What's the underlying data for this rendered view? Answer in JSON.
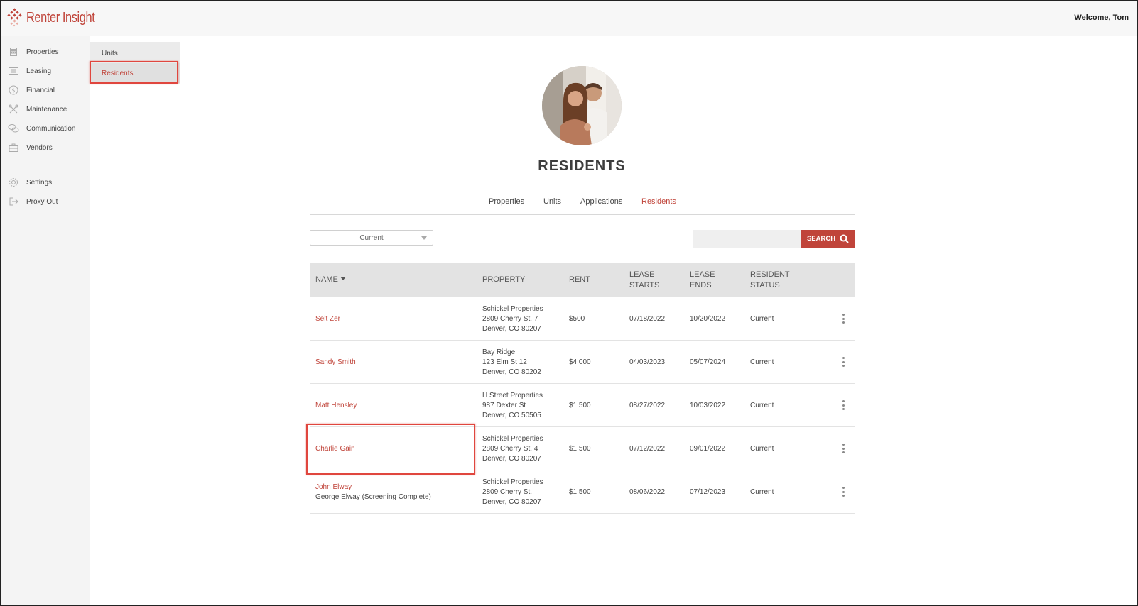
{
  "brand": {
    "name": "Renter Insight",
    "color": "#c0443a"
  },
  "header": {
    "welcome": "Welcome, Tom"
  },
  "leftnav": {
    "items": [
      {
        "label": "Properties",
        "icon": "building-icon"
      },
      {
        "label": "Leasing",
        "icon": "list-icon"
      },
      {
        "label": "Financial",
        "icon": "dollar-icon"
      },
      {
        "label": "Maintenance",
        "icon": "tools-icon"
      },
      {
        "label": "Communication",
        "icon": "chat-icon"
      },
      {
        "label": "Vendors",
        "icon": "briefcase-icon"
      },
      {
        "label": "Settings",
        "icon": "gear-icon"
      },
      {
        "label": "Proxy Out",
        "icon": "logout-icon"
      }
    ]
  },
  "subnav": {
    "items": [
      {
        "label": "Units"
      },
      {
        "label": "Residents",
        "active": true
      }
    ]
  },
  "page": {
    "title": "RESIDENTS"
  },
  "tabs": [
    {
      "label": "Properties"
    },
    {
      "label": "Units"
    },
    {
      "label": "Applications"
    },
    {
      "label": "Residents",
      "active": true
    }
  ],
  "filters": {
    "status_selected": "Current",
    "search_value": "",
    "search_label": "SEARCH"
  },
  "table": {
    "headers": {
      "name": "NAME",
      "property": "PROPERTY",
      "rent": "RENT",
      "lease_starts_1": "LEASE",
      "lease_starts_2": "STARTS",
      "lease_ends_1": "LEASE",
      "lease_ends_2": "ENDS",
      "status_1": "RESIDENT",
      "status_2": "STATUS"
    },
    "rows": [
      {
        "name": "Selt Zer",
        "sub": "",
        "property": [
          "Schickel Properties",
          "2809 Cherry St. 7",
          "Denver, CO 80207"
        ],
        "rent": "$500",
        "start": "07/18/2022",
        "end": "10/20/2022",
        "status": "Current"
      },
      {
        "name": "Sandy Smith",
        "sub": "",
        "property": [
          "Bay Ridge",
          "123 Elm St 12",
          "Denver, CO 80202"
        ],
        "rent": "$4,000",
        "start": "04/03/2023",
        "end": "05/07/2024",
        "status": "Current"
      },
      {
        "name": "Matt Hensley",
        "sub": "",
        "property": [
          "H Street Properties",
          "987 Dexter St",
          "Denver, CO 50505"
        ],
        "rent": "$1,500",
        "start": "08/27/2022",
        "end": "10/03/2022",
        "status": "Current"
      },
      {
        "name": "Charlie Gain",
        "sub": "",
        "property": [
          "Schickel Properties",
          "2809 Cherry St. 4",
          "Denver, CO 80207"
        ],
        "rent": "$1,500",
        "start": "07/12/2022",
        "end": "09/01/2022",
        "status": "Current"
      },
      {
        "name": "John Elway",
        "sub": "George Elway  (Screening Complete)",
        "property": [
          "Schickel Properties",
          "2809 Cherry St.",
          "Denver, CO 80207"
        ],
        "rent": "$1,500",
        "start": "08/06/2022",
        "end": "07/12/2023",
        "status": "Current"
      }
    ]
  }
}
